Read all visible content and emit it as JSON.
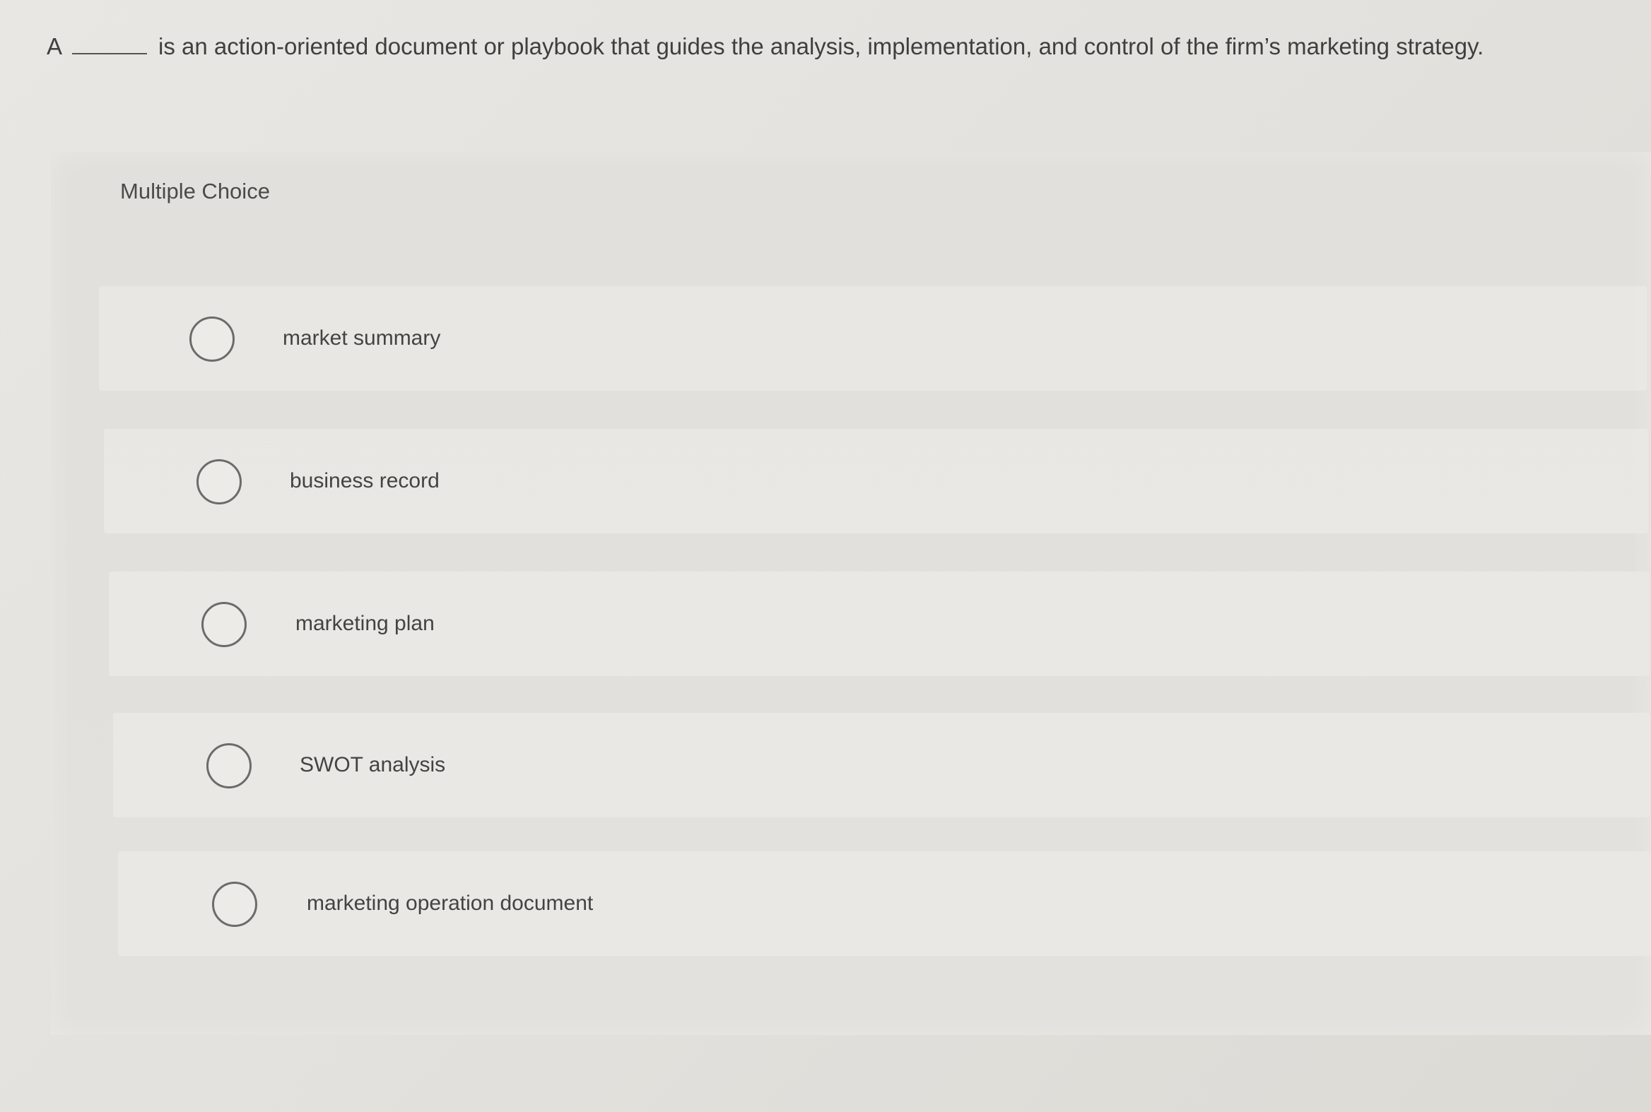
{
  "question": {
    "article": "A",
    "stem": "is an action-oriented document or playbook that guides the analysis, implementation, and control of the firm’s marketing strategy."
  },
  "panel": {
    "type_label": "Multiple Choice",
    "choices": [
      {
        "label": "market summary",
        "selected": false
      },
      {
        "label": "business record",
        "selected": false
      },
      {
        "label": "marketing plan",
        "selected": false
      },
      {
        "label": "SWOT analysis",
        "selected": false
      },
      {
        "label": "marketing operation document",
        "selected": false
      }
    ]
  }
}
